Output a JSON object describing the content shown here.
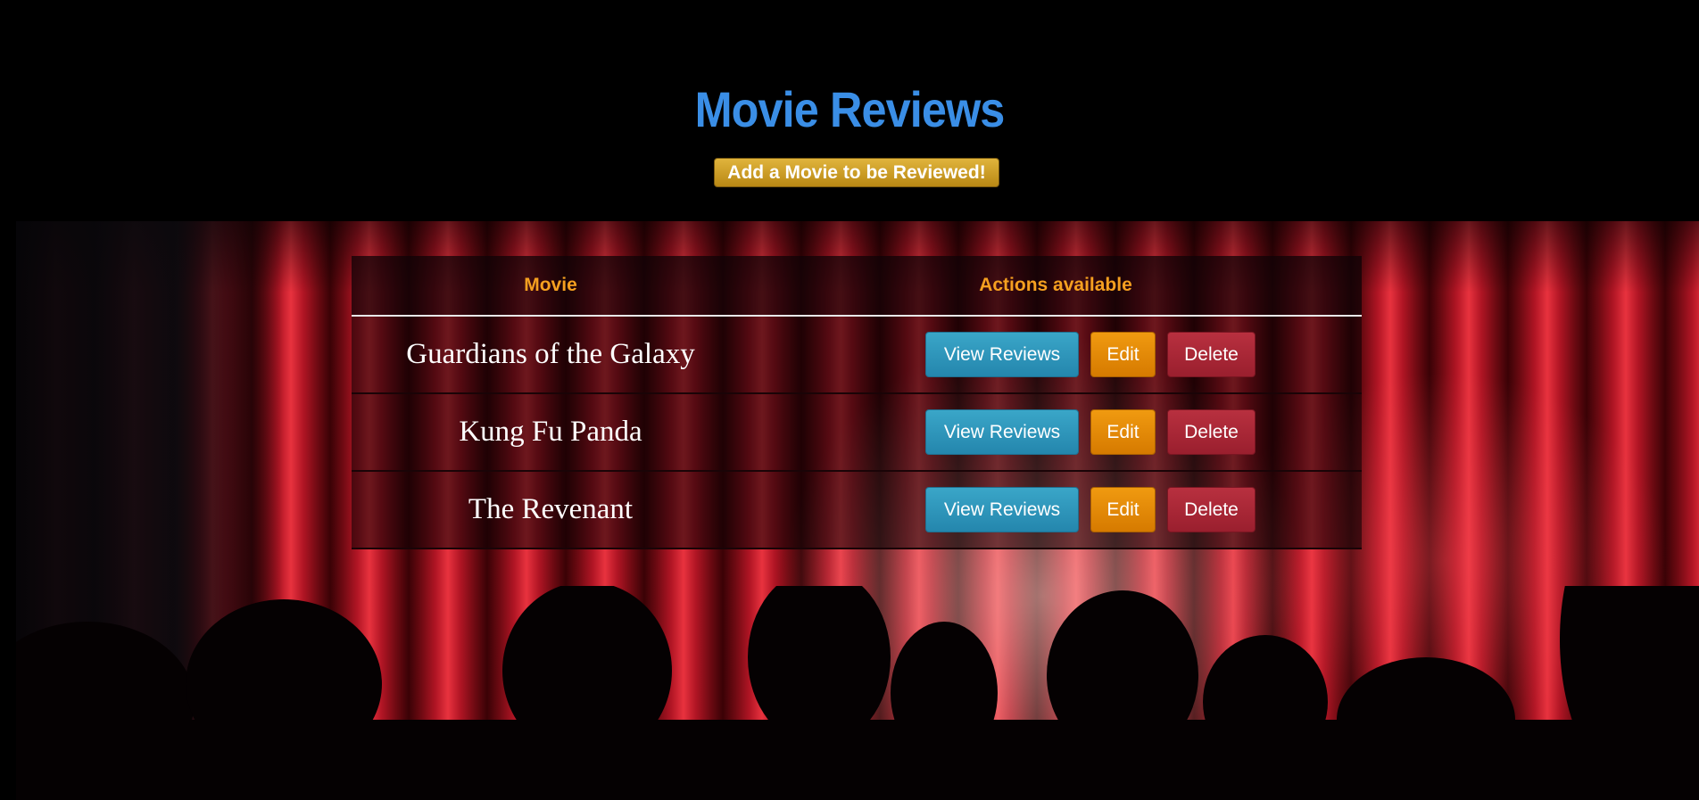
{
  "page": {
    "title": "Movie Reviews",
    "add_button_label": "Add a Movie to be Reviewed!"
  },
  "table": {
    "headers": {
      "movie": "Movie",
      "actions": "Actions available"
    },
    "rows": [
      {
        "movie": "Guardians of the Galaxy",
        "view_label": "View Reviews",
        "edit_label": "Edit",
        "delete_label": "Delete"
      },
      {
        "movie": "Kung Fu Panda",
        "view_label": "View Reviews",
        "edit_label": "Edit",
        "delete_label": "Delete"
      },
      {
        "movie": "The Revenant",
        "view_label": "View Reviews",
        "edit_label": "Edit",
        "delete_label": "Delete"
      }
    ]
  },
  "colors": {
    "title": "#3a8ee6",
    "header_text": "#f5a020",
    "view_button": "#2b93b8",
    "edit_button": "#e08800",
    "delete_button": "#a82636",
    "add_button": "#cfa02a"
  },
  "background": {
    "icon": "theater-stage-curtain-image"
  }
}
